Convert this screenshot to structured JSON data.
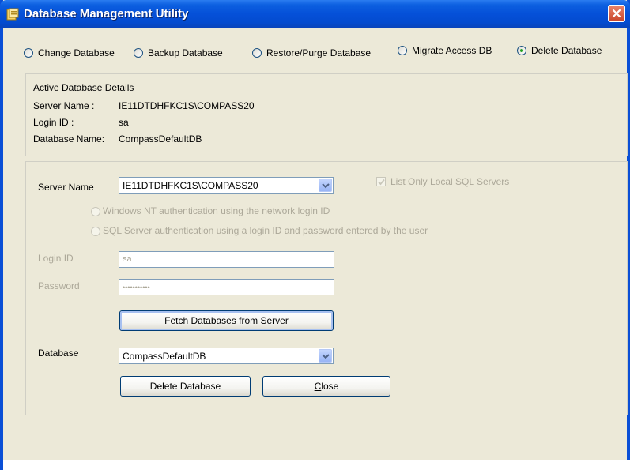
{
  "window": {
    "title": "Database Management Utility"
  },
  "modes": [
    {
      "label": "Change Database",
      "selected": false
    },
    {
      "label": "Backup Database",
      "selected": false
    },
    {
      "label": "Restore/Purge Database",
      "selected": false
    },
    {
      "label": "Migrate Access DB",
      "selected": false
    },
    {
      "label": "Delete Database",
      "selected": true
    }
  ],
  "active_details": {
    "heading": "Active Database Details",
    "server_label": "Server Name :",
    "server_value": "IE11DTDHFKC1S\\COMPASS20",
    "login_label": "Login ID :",
    "login_value": "sa",
    "db_label": "Database  Name:",
    "db_value": "CompassDefaultDB"
  },
  "form": {
    "server_label": "Server Name",
    "server_value": "IE11DTDHFKC1S\\COMPASS20",
    "list_only_local": "List Only Local SQL Servers",
    "auth_windows": "Windows NT authentication using the network login ID",
    "auth_sql": "SQL Server authentication using a login ID and password entered by the user",
    "login_label": "Login ID",
    "login_value": "sa",
    "password_label": "Password",
    "password_value": "•••••••••••",
    "fetch_button": "Fetch Databases from Server",
    "database_label": "Database",
    "database_value": "CompassDefaultDB",
    "delete_button": "Delete Database",
    "close_button_prefix": "",
    "close_button_mnemonic": "C",
    "close_button_rest": "lose"
  }
}
